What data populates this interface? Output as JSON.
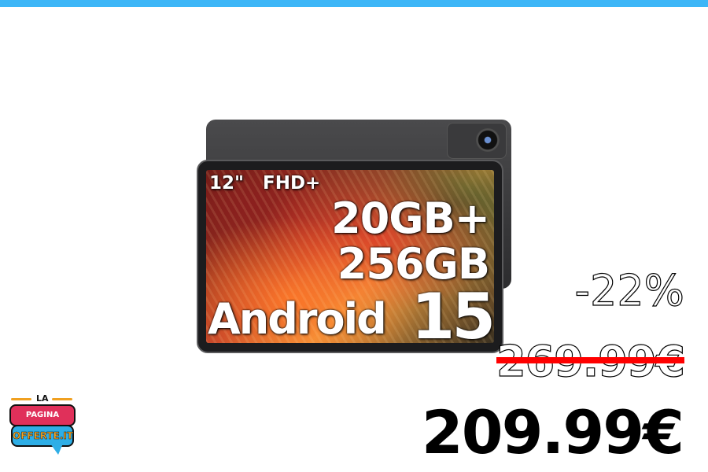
{
  "colors": {
    "top_bar": "#3db6f7",
    "strike": "#ff0000",
    "price": "#000000"
  },
  "product": {
    "screen_size": "12\"",
    "resolution": "FHD+",
    "ram": "20GB+",
    "storage": "256GB",
    "os": "Android",
    "os_version": "15"
  },
  "pricing": {
    "discount": "-22%",
    "old_price": "269.99€",
    "price": "209.99€"
  },
  "logo": {
    "line1": "LA",
    "line2": "PAGINA DELLE",
    "line3": "OFFERTE.IT"
  }
}
